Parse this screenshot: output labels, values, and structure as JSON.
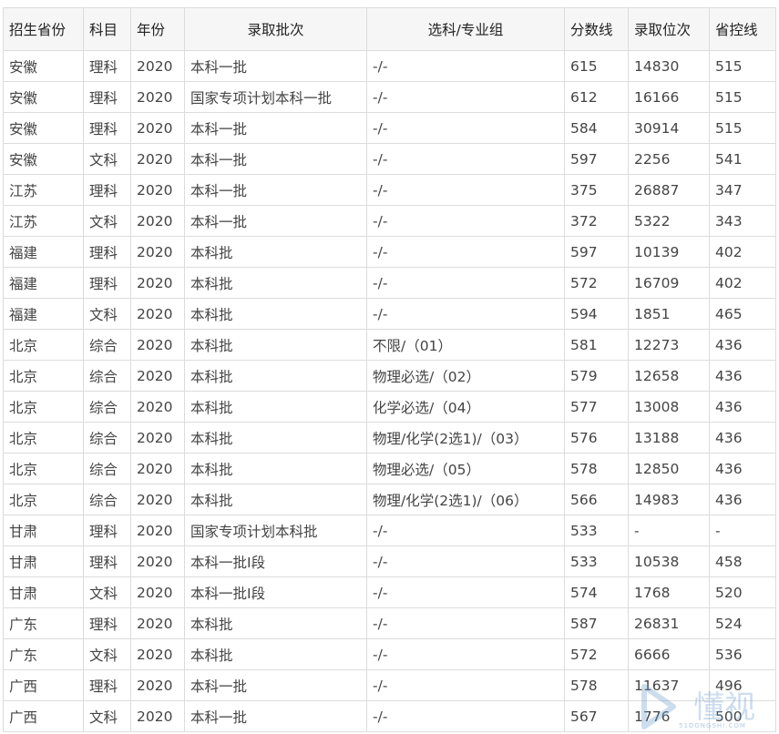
{
  "table": {
    "headers": [
      "招生省份",
      "科目",
      "年份",
      "录取批次",
      "选科/专业组",
      "分数线",
      "录取位次",
      "省控线"
    ],
    "rows": [
      [
        "安徽",
        "理科",
        "2020",
        "本科一批",
        "-/-",
        "615",
        "14830",
        "515"
      ],
      [
        "安徽",
        "理科",
        "2020",
        "国家专项计划本科一批",
        "-/-",
        "612",
        "16166",
        "515"
      ],
      [
        "安徽",
        "理科",
        "2020",
        "本科一批",
        "-/-",
        "584",
        "30914",
        "515"
      ],
      [
        "安徽",
        "文科",
        "2020",
        "本科一批",
        "-/-",
        "597",
        "2256",
        "541"
      ],
      [
        "江苏",
        "理科",
        "2020",
        "本科一批",
        "-/-",
        "375",
        "26887",
        "347"
      ],
      [
        "江苏",
        "文科",
        "2020",
        "本科一批",
        "-/-",
        "372",
        "5322",
        "343"
      ],
      [
        "福建",
        "理科",
        "2020",
        "本科批",
        "-/-",
        "597",
        "10139",
        "402"
      ],
      [
        "福建",
        "理科",
        "2020",
        "本科批",
        "-/-",
        "572",
        "16709",
        "402"
      ],
      [
        "福建",
        "文科",
        "2020",
        "本科批",
        "-/-",
        "594",
        "1851",
        "465"
      ],
      [
        "北京",
        "综合",
        "2020",
        "本科批",
        "不限/（01）",
        "581",
        "12273",
        "436"
      ],
      [
        "北京",
        "综合",
        "2020",
        "本科批",
        "物理必选/（02）",
        "579",
        "12658",
        "436"
      ],
      [
        "北京",
        "综合",
        "2020",
        "本科批",
        "化学必选/（04）",
        "577",
        "13008",
        "436"
      ],
      [
        "北京",
        "综合",
        "2020",
        "本科批",
        "物理/化学(2选1)/（03）",
        "576",
        "13188",
        "436"
      ],
      [
        "北京",
        "综合",
        "2020",
        "本科批",
        "物理必选/（05）",
        "578",
        "12850",
        "436"
      ],
      [
        "北京",
        "综合",
        "2020",
        "本科批",
        "物理/化学(2选1)/（06）",
        "566",
        "14983",
        "436"
      ],
      [
        "甘肃",
        "理科",
        "2020",
        "国家专项计划本科批",
        "-/-",
        "533",
        "-",
        "-"
      ],
      [
        "甘肃",
        "理科",
        "2020",
        "本科一批I段",
        "-/-",
        "533",
        "10538",
        "458"
      ],
      [
        "甘肃",
        "文科",
        "2020",
        "本科一批I段",
        "-/-",
        "574",
        "1768",
        "520"
      ],
      [
        "广东",
        "理科",
        "2020",
        "本科批",
        "-/-",
        "587",
        "26831",
        "524"
      ],
      [
        "广东",
        "文科",
        "2020",
        "本科批",
        "-/-",
        "572",
        "6666",
        "536"
      ],
      [
        "广西",
        "理科",
        "2020",
        "本科一批",
        "-/-",
        "578",
        "11637",
        "496"
      ],
      [
        "广西",
        "文科",
        "2020",
        "本科一批",
        "-/-",
        "567",
        "1776",
        "500"
      ]
    ]
  },
  "watermark": {
    "text": "懂视",
    "subtext": "51DONGSHI.COM",
    "color": "#6f9fd0"
  }
}
